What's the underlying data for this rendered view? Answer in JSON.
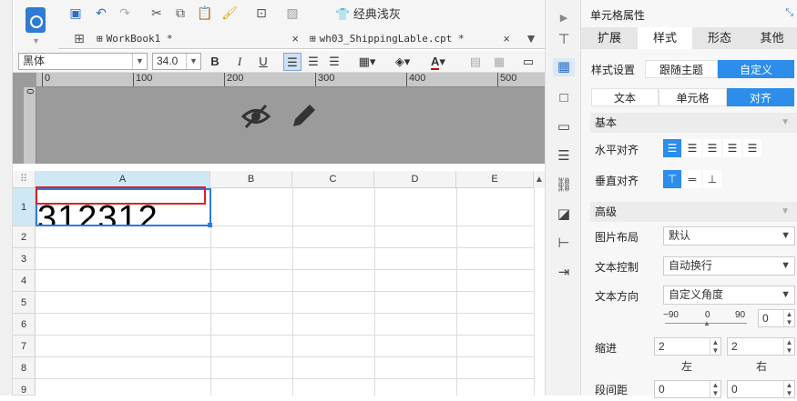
{
  "toolbar": {
    "theme_label": "经典浅灰"
  },
  "tabs": [
    {
      "label": "WorkBook1 *"
    },
    {
      "label": "wh03_ShippingLable.cpt *"
    }
  ],
  "format": {
    "font_name": "黑体",
    "font_size": "34.0",
    "bold": "B",
    "italic": "I",
    "underline": "U"
  },
  "preview": {
    "ruler_ticks": [
      "0",
      "100",
      "200",
      "300",
      "400",
      "500"
    ],
    "vruler_label": "0"
  },
  "grid": {
    "corner": "⠿",
    "columns": [
      "A",
      "B",
      "C",
      "D",
      "E"
    ],
    "rows": [
      "1",
      "2",
      "3",
      "4",
      "5",
      "6",
      "7",
      "8",
      "9"
    ],
    "cell_a1": "312312"
  },
  "panel": {
    "title": "单元格属性",
    "tabs": [
      "扩展",
      "样式",
      "形态",
      "其他"
    ],
    "style_setting_label": "样式设置",
    "style_options": [
      "跟随主题",
      "自定义"
    ],
    "sub_tabs": [
      "文本",
      "单元格",
      "对齐"
    ],
    "section_basic": "基本",
    "h_align_label": "水平对齐",
    "v_align_label": "垂直对齐",
    "section_advanced": "高级",
    "image_layout_label": "图片布局",
    "image_layout_value": "默认",
    "text_control_label": "文本控制",
    "text_control_value": "自动换行",
    "text_dir_label": "文本方向",
    "text_dir_value": "自定义角度",
    "angle_min": "−90",
    "angle_mid": "0",
    "angle_max": "90",
    "angle_value": "0",
    "indent_label": "缩进",
    "indent_left": "2",
    "indent_right": "2",
    "indent_left_label": "左",
    "indent_right_label": "右",
    "para_label": "段间距",
    "para_left": "0",
    "para_right": "0"
  }
}
